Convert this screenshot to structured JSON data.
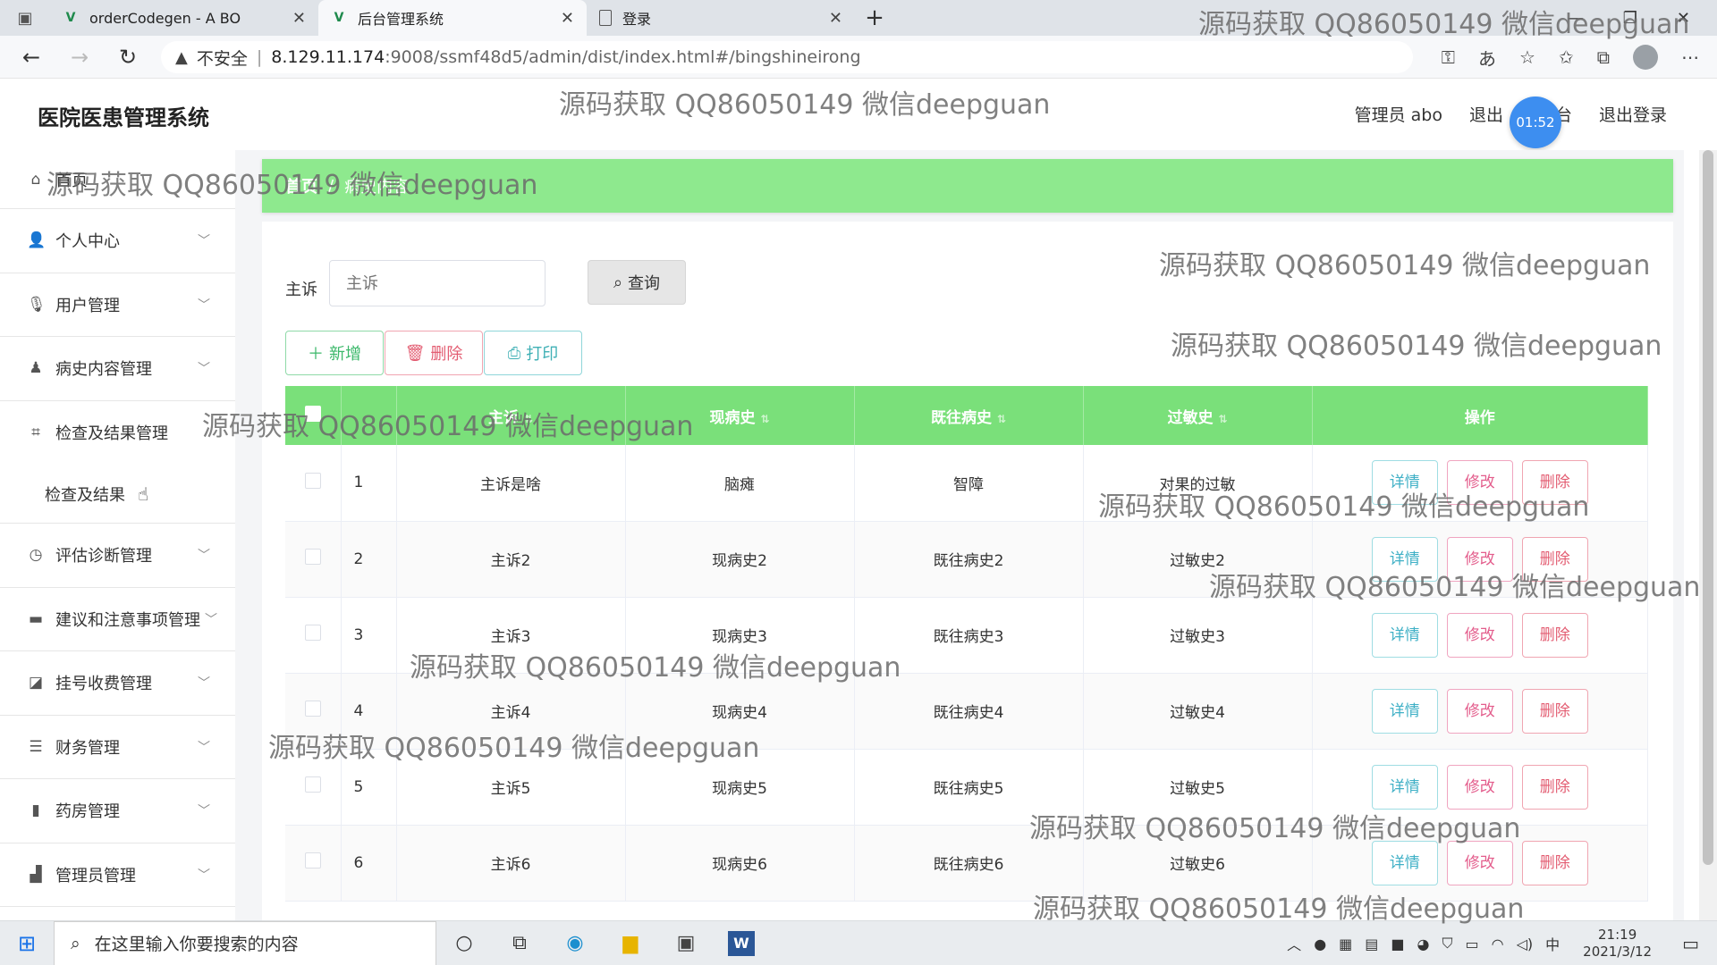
{
  "browser": {
    "tabs": [
      {
        "title": "orderCodegen - A BO",
        "icon": "vue-icon",
        "active": false
      },
      {
        "title": "后台管理系统",
        "icon": "vue-icon",
        "active": true
      },
      {
        "title": "登录",
        "icon": "document-icon",
        "active": false
      }
    ],
    "url": {
      "warning": "不安全",
      "separator": "|",
      "host": "8.129.11.174",
      "path": ":9008/ssmf48d5/admin/dist/index.html#/bingshineirong"
    }
  },
  "app": {
    "title": "医院医患管理系统",
    "user": "管理员 abo",
    "logout_left": "退出",
    "logout_partial": "台",
    "logout": "退出登录",
    "clock": "01:52"
  },
  "sidebar": {
    "home": "首页",
    "items": [
      {
        "label": "个人中心",
        "icon": "user-icon"
      },
      {
        "label": "用户管理",
        "icon": "mic-icon"
      },
      {
        "label": "病史内容管理",
        "icon": "person-icon"
      },
      {
        "label": "检查及结果管理",
        "icon": "crop-icon"
      },
      {
        "label": "检查及结果",
        "icon": ""
      },
      {
        "label": "评估诊断管理",
        "icon": "clock-icon"
      },
      {
        "label": "建议和注意事项管理",
        "icon": "briefcase-icon"
      },
      {
        "label": "挂号收费管理",
        "icon": "chart-icon"
      },
      {
        "label": "财务管理",
        "icon": "list-icon"
      },
      {
        "label": "药房管理",
        "icon": "bar-icon"
      },
      {
        "label": "管理员管理",
        "icon": "bar-chart-icon"
      }
    ]
  },
  "breadcrumb": {
    "first": "首页",
    "separator": "/",
    "second": "病史内容"
  },
  "search": {
    "label": "主诉",
    "placeholder": "主诉",
    "button": "查询"
  },
  "actions": {
    "add": "新增",
    "delete": "删除",
    "print": "打印"
  },
  "table": {
    "headers": [
      "主诉",
      "现病史",
      "既往病史",
      "过敏史",
      "操作"
    ],
    "rows": [
      {
        "idx": "1",
        "zhusu": "主诉是啥",
        "xianbingshi": "脑瘫",
        "jiwang": "智障",
        "guomin": "对果的过敏"
      },
      {
        "idx": "2",
        "zhusu": "主诉2",
        "xianbingshi": "现病史2",
        "jiwang": "既往病史2",
        "guomin": "过敏史2"
      },
      {
        "idx": "3",
        "zhusu": "主诉3",
        "xianbingshi": "现病史3",
        "jiwang": "既往病史3",
        "guomin": "过敏史3"
      },
      {
        "idx": "4",
        "zhusu": "主诉4",
        "xianbingshi": "现病史4",
        "jiwang": "既往病史4",
        "guomin": "过敏史4"
      },
      {
        "idx": "5",
        "zhusu": "主诉5",
        "xianbingshi": "现病史5",
        "jiwang": "既往病史5",
        "guomin": "过敏史5"
      },
      {
        "idx": "6",
        "zhusu": "主诉6",
        "xianbingshi": "现病史6",
        "jiwang": "既往病史6",
        "guomin": "过敏史6"
      }
    ],
    "op": {
      "detail": "详情",
      "edit": "修改",
      "remove": "删除"
    }
  },
  "watermark": "源码获取 QQ86050149 微信deepguan",
  "taskbar": {
    "search_placeholder": "在这里输入你要搜索的内容",
    "ime": "中",
    "time": "21:19",
    "date": "2021/3/12"
  }
}
